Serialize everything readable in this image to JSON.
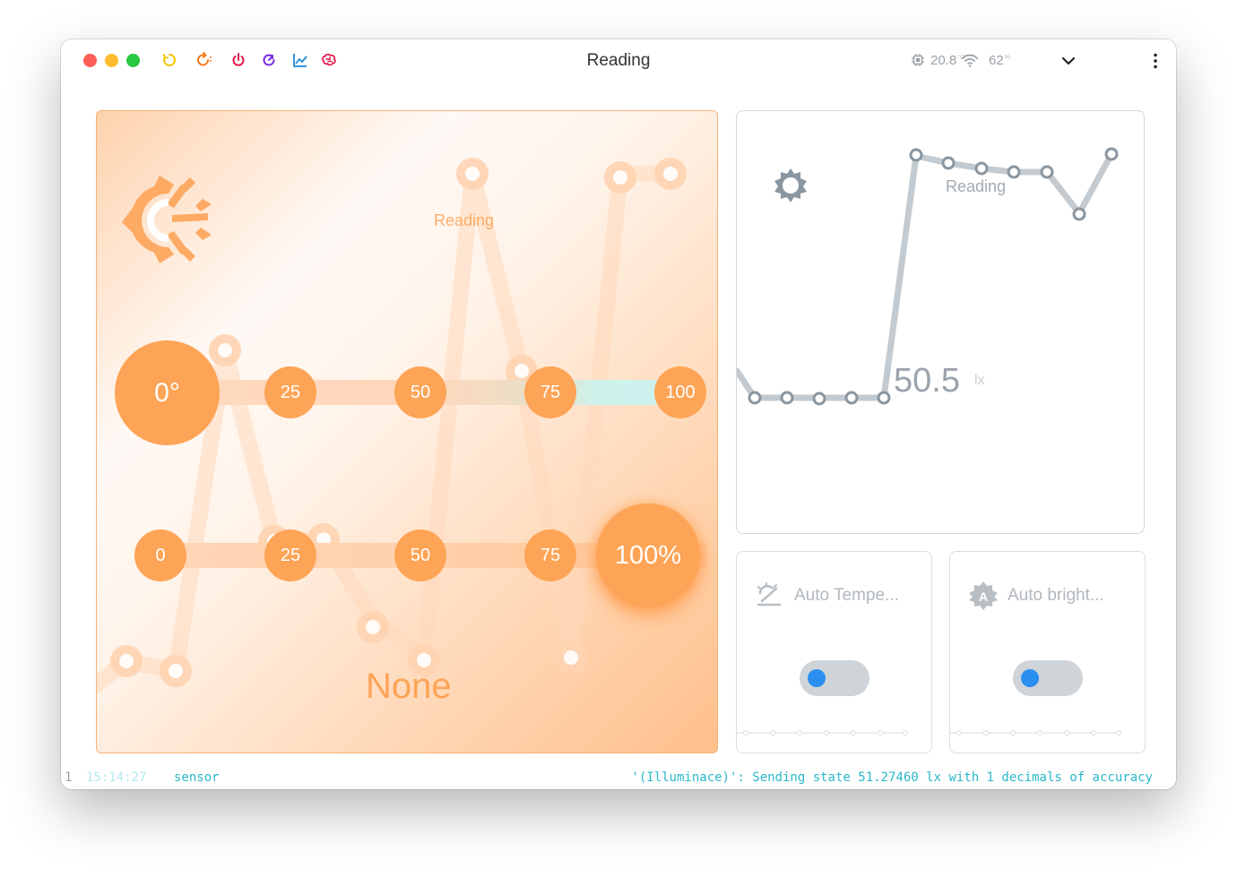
{
  "window": {
    "title": "Reading"
  },
  "toolbar": {
    "icons": [
      "restart-yellow-icon",
      "restart-orange-icon",
      "power-icon",
      "refresh-icon",
      "chart-icon",
      "brain-icon"
    ]
  },
  "status": {
    "temperature": "20.8",
    "temperature_unit": "°C",
    "signal": "62",
    "signal_unit": "%"
  },
  "main_card": {
    "label": "Reading",
    "value": "None",
    "color_temp_knobs": [
      "25",
      "50",
      "75",
      "100"
    ],
    "color_temp_value": "0°",
    "brightness_knobs": [
      "0",
      "25",
      "50",
      "75"
    ],
    "brightness_value": "100%",
    "accent": "#fea456"
  },
  "chart_card": {
    "label": "Reading",
    "value": "50.5",
    "unit": "lx",
    "line_color": "#c3cbd1",
    "point_color": "#8a96a0"
  },
  "toggles": [
    {
      "label": "Auto Tempe...",
      "icon": "auto-temperature-icon",
      "on": false
    },
    {
      "label": "Auto bright...",
      "icon": "auto-brightness-icon",
      "on": false
    }
  ],
  "log": {
    "line": "1",
    "time": "15:14:27",
    "source": "sensor",
    "message": "'(Illuminace)': Sending state 51.27460 lx with 1 decimals of accuracy"
  }
}
